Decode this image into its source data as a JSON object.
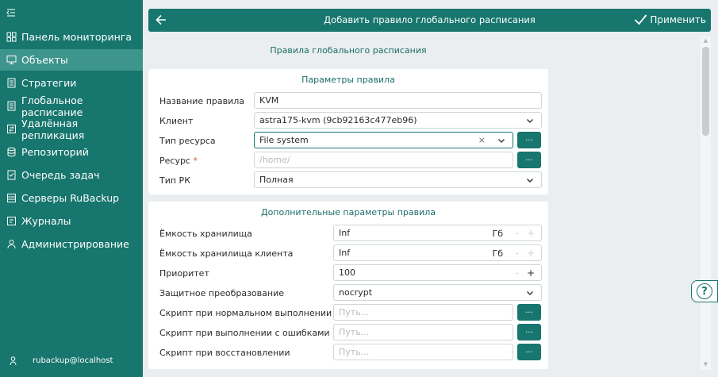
{
  "colors": {
    "brand": "#17766e",
    "sidebar_active": "#3e958d",
    "required": "#d9534f"
  },
  "sidebar": {
    "collapse_icon": "collapse-icon",
    "items": [
      {
        "label": "Панель мониторинга",
        "icon": "dashboard-icon"
      },
      {
        "label": "Объекты",
        "icon": "monitor-icon",
        "active": true
      },
      {
        "label": "Стратегии",
        "icon": "strategy-icon"
      },
      {
        "label": "Глобальное расписание",
        "icon": "schedule-icon"
      },
      {
        "label": "Удалённая репликация",
        "icon": "replication-icon"
      },
      {
        "label": "Репозиторий",
        "icon": "database-icon"
      },
      {
        "label": "Очередь задач",
        "icon": "task-queue-icon"
      },
      {
        "label": "Серверы RuBackup",
        "icon": "server-icon"
      },
      {
        "label": "Журналы",
        "icon": "journal-icon"
      },
      {
        "label": "Администрирование",
        "icon": "admin-icon"
      }
    ],
    "user": "rubackup@localhost"
  },
  "header": {
    "title": "Добавить правило глобального расписания",
    "apply_label": "Применить"
  },
  "page": {
    "section_title": "Правила глобального расписания"
  },
  "rule_params": {
    "title": "Параметры правила",
    "name_label": "Название правила",
    "name_value": "KVM",
    "client_label": "Клиент",
    "client_value": "astra175-kvm (9cb92163c477eb96)",
    "resource_type_label": "Тип ресурса",
    "resource_type_value": "File system",
    "resource_label": "Ресурс",
    "resource_required": "*",
    "resource_placeholder": "/home/",
    "backup_type_label": "Тип РК",
    "backup_type_value": "Полная",
    "dots": "..."
  },
  "extra_params": {
    "title": "Дополнительные параметры правила",
    "storage_label": "Ёмкость хранилища",
    "storage_value": "Inf",
    "storage_unit": "Гб",
    "client_storage_label": "Ёмкость хранилища клиента",
    "client_storage_value": "Inf",
    "client_storage_unit": "Гб",
    "priority_label": "Приоритет",
    "priority_value": "100",
    "protection_label": "Защитное преобразование",
    "protection_value": "nocrypt",
    "script_normal_label": "Скрипт при нормальном выполнении",
    "script_error_label": "Скрипт при выполнении с ошибками",
    "script_restore_label": "Скрипт при восстановлении",
    "path_placeholder": "Путь...",
    "minus": "-",
    "plus": "+"
  },
  "help": {
    "label": "?"
  }
}
